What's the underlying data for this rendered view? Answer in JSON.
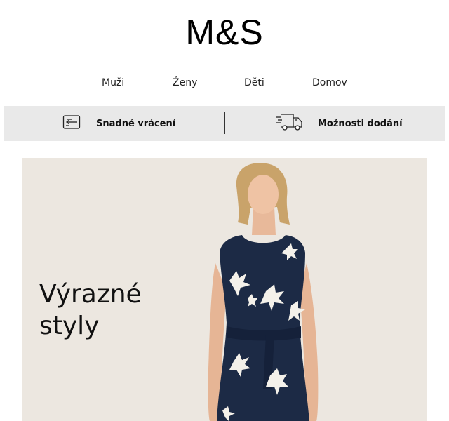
{
  "brand": {
    "logo_text": "M&S"
  },
  "nav": {
    "items": [
      {
        "label": "Muži"
      },
      {
        "label": "Ženy"
      },
      {
        "label": "Děti"
      },
      {
        "label": "Domov"
      }
    ]
  },
  "services": [
    {
      "label": "Snadné vrácení",
      "icon": "returns-icon"
    },
    {
      "label": "Možnosti dodání",
      "icon": "delivery-truck-icon"
    }
  ],
  "hero": {
    "title": "Výrazné\nstyly",
    "image": "woman-in-navy-floral-dress",
    "background_color": "#ece7e0",
    "dress_color": "#1c2a45"
  }
}
